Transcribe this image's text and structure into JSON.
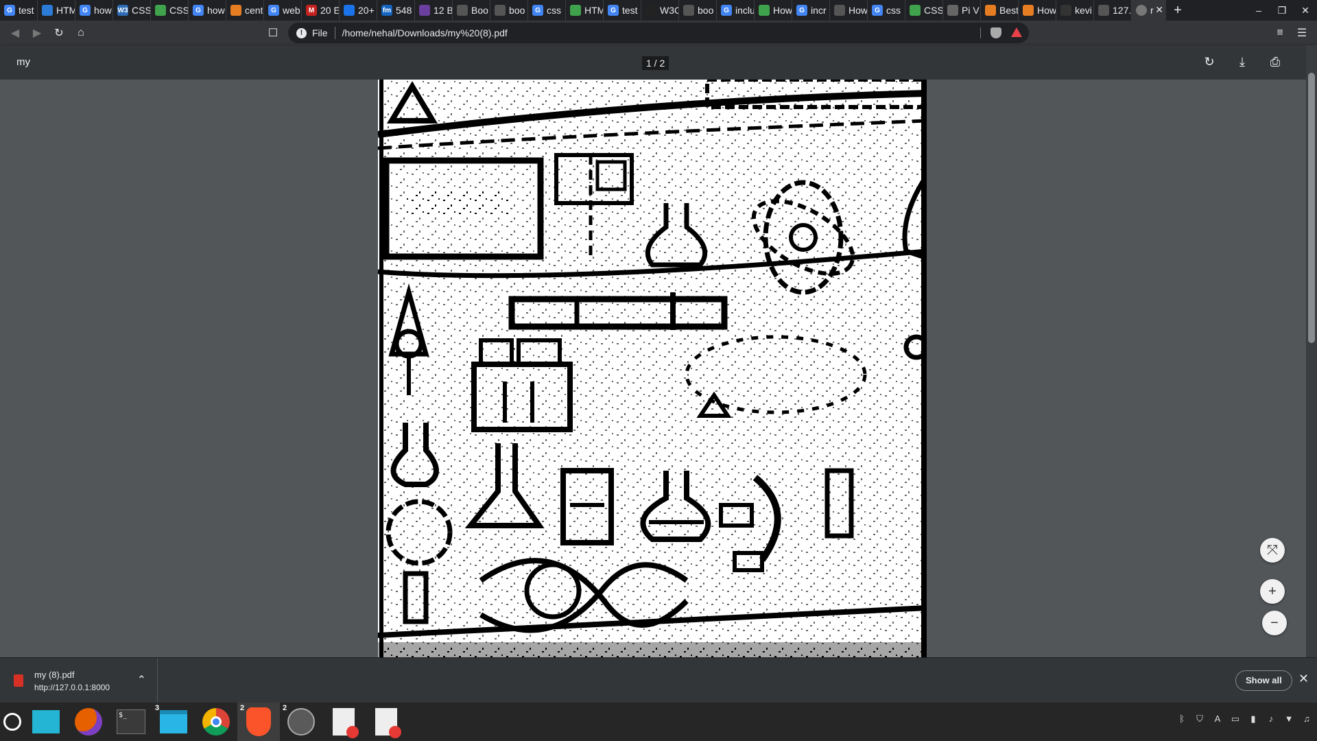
{
  "tabs": [
    {
      "label": "test",
      "fav": "G",
      "color": "#4285f4"
    },
    {
      "label": "HTM",
      "fav": "",
      "color": "#2c7bd6"
    },
    {
      "label": "how",
      "fav": "G",
      "color": "#4285f4"
    },
    {
      "label": "CSS",
      "fav": "W3",
      "color": "#2d6cb5"
    },
    {
      "label": "CSS",
      "fav": "",
      "color": "#3fa34d"
    },
    {
      "label": "how",
      "fav": "G",
      "color": "#4285f4"
    },
    {
      "label": "cent",
      "fav": "",
      "color": "#e77d22"
    },
    {
      "label": "web",
      "fav": "G",
      "color": "#4285f4"
    },
    {
      "label": "20 E",
      "fav": "M",
      "color": "#c5221f"
    },
    {
      "label": "20+",
      "fav": "",
      "color": "#1a73e8"
    },
    {
      "label": "548",
      "fav": "fm",
      "color": "#1565c0"
    },
    {
      "label": "12 B",
      "fav": "",
      "color": "#6b3fa0"
    },
    {
      "label": "Boo",
      "fav": "",
      "color": "#555"
    },
    {
      "label": "boo",
      "fav": "",
      "color": "#555"
    },
    {
      "label": "css",
      "fav": "G",
      "color": "#4285f4"
    },
    {
      "label": "HTM",
      "fav": "",
      "color": "#3fa34d"
    },
    {
      "label": "test",
      "fav": "G",
      "color": "#4285f4"
    },
    {
      "label": "W3C",
      "fav": "",
      "color": "#222"
    },
    {
      "label": "boo",
      "fav": "",
      "color": "#555"
    },
    {
      "label": "inclu",
      "fav": "G",
      "color": "#4285f4"
    },
    {
      "label": "How",
      "fav": "",
      "color": "#3fa34d"
    },
    {
      "label": "incr",
      "fav": "G",
      "color": "#4285f4"
    },
    {
      "label": "How",
      "fav": "",
      "color": "#555"
    },
    {
      "label": "css",
      "fav": "G",
      "color": "#4285f4"
    },
    {
      "label": "CSS",
      "fav": "",
      "color": "#3fa34d"
    },
    {
      "label": "Pi V",
      "fav": "",
      "color": "#666"
    },
    {
      "label": "Best",
      "fav": "",
      "color": "#e77d22"
    },
    {
      "label": "How",
      "fav": "",
      "color": "#e77d22"
    },
    {
      "label": "kevi",
      "fav": "",
      "color": "#333"
    },
    {
      "label": "127.",
      "fav": "",
      "color": "#555"
    }
  ],
  "active_tab": {
    "label": "r"
  },
  "toolbar": {
    "file_label": "File",
    "url": "/home/nehal/Downloads/my%20(8).pdf"
  },
  "pdf": {
    "title": "my",
    "page_indicator": "1 / 2"
  },
  "download": {
    "filename": "my (8).pdf",
    "source": "http://127.0.0.1:8000",
    "show_all": "Show all"
  },
  "taskbar": {
    "files_badge": "3",
    "brave_badge": "2",
    "atom_badge": "2"
  },
  "colors": {
    "tabstrip": "#202124",
    "toolbar": "#35363a",
    "pdfbar": "#323639",
    "viewer_bg": "#525659"
  }
}
